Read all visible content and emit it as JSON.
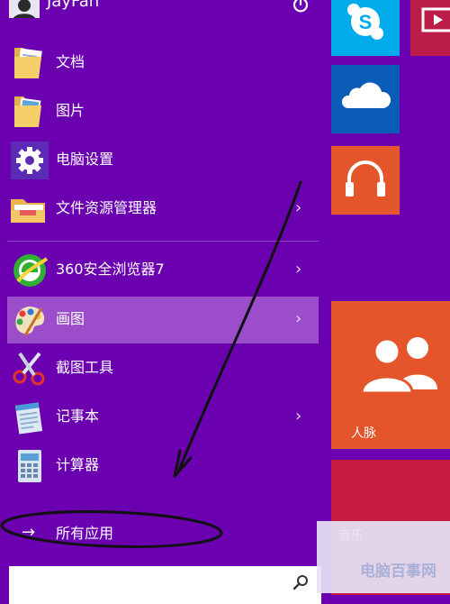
{
  "user": {
    "name": "JayFan"
  },
  "left_menu": [
    {
      "label": "文档",
      "icon": "documents-folder-icon",
      "has_arrow": false
    },
    {
      "label": "图片",
      "icon": "pictures-folder-icon",
      "has_arrow": false
    },
    {
      "label": "电脑设置",
      "icon": "settings-gear-icon",
      "has_arrow": false
    },
    {
      "label": "文件资源管理器",
      "icon": "file-explorer-icon",
      "has_arrow": true
    },
    {
      "label": "360安全浏览器7",
      "icon": "360-browser-icon",
      "has_arrow": true
    },
    {
      "label": "画图",
      "icon": "paint-palette-icon",
      "has_arrow": true,
      "selected": true
    },
    {
      "label": "截图工具",
      "icon": "snipping-tool-icon",
      "has_arrow": false
    },
    {
      "label": "记事本",
      "icon": "notepad-icon",
      "has_arrow": true
    },
    {
      "label": "计算器",
      "icon": "calculator-icon",
      "has_arrow": false
    }
  ],
  "all_apps": {
    "label": "所有应用",
    "arrow": "→"
  },
  "search": {
    "placeholder": ""
  },
  "tiles": {
    "people_label": "人脉",
    "partial_label": "音乐"
  },
  "chevron_glyph": "›",
  "colors": {
    "background": "#6a00b0",
    "selected_item": "#9b4dca",
    "skype_tile": "#00abec",
    "onedrive_tile": "#0b5bb9",
    "music_tile": "#e4552b",
    "people_tile": "#e4552b",
    "red_tile": "#c51b41"
  },
  "watermark": {
    "text": "电脑百事网"
  }
}
